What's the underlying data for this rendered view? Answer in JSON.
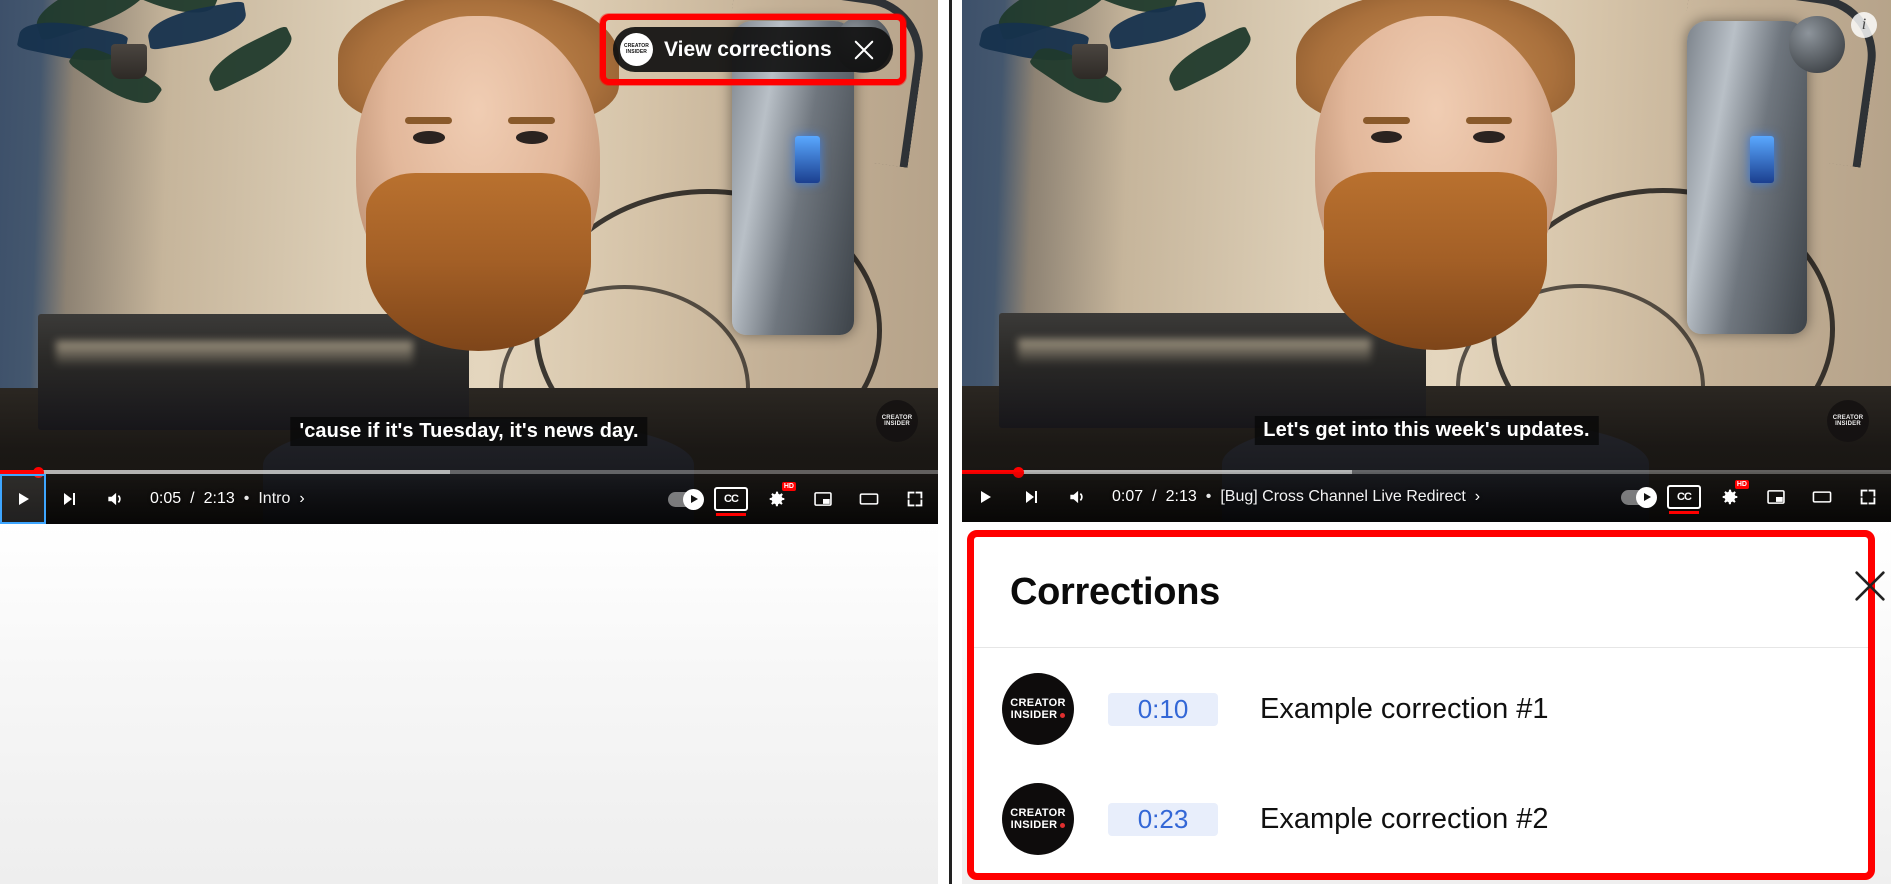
{
  "left_player": {
    "highlight_pill": {
      "avatar_line1": "CREATOR",
      "avatar_line2": "INSIDER",
      "label": "View corrections",
      "close_icon": "close-icon"
    },
    "caption": "'cause if it's Tuesday, it's news day.",
    "watermark_line1": "CREATOR",
    "watermark_line2": "INSIDER",
    "controls": {
      "play_icon": "play-icon",
      "next_icon": "next-video-icon",
      "volume_icon": "volume-icon",
      "current_time": "0:05",
      "separator": "/",
      "duration": "2:13",
      "chapter_dot": "•",
      "chapter": "Intro",
      "chapter_chevron": "›",
      "autoplay_icon": "autoplay-toggle",
      "captions_icon": "closed-captions-icon",
      "captions_label": "CC",
      "settings_icon": "settings-gear-icon",
      "settings_badge": "HD",
      "miniplayer_icon": "miniplayer-icon",
      "theater_icon": "theater-mode-icon",
      "fullscreen_icon": "fullscreen-icon"
    },
    "progress": {
      "played_percent": 4,
      "buffered_percent": 48
    }
  },
  "right_player": {
    "info_icon": "info-icon",
    "caption": "Let's get into this week's updates.",
    "watermark_line1": "CREATOR",
    "watermark_line2": "INSIDER",
    "controls": {
      "play_icon": "play-icon",
      "next_icon": "next-video-icon",
      "volume_icon": "volume-icon",
      "current_time": "0:07",
      "separator": "/",
      "duration": "2:13",
      "chapter_dot": "•",
      "chapter": "[Bug] Cross Channel Live Redirect",
      "chapter_chevron": "›",
      "autoplay_icon": "autoplay-toggle",
      "captions_icon": "closed-captions-icon",
      "captions_label": "CC",
      "settings_icon": "settings-gear-icon",
      "settings_badge": "HD",
      "miniplayer_icon": "miniplayer-icon",
      "theater_icon": "theater-mode-icon",
      "fullscreen_icon": "fullscreen-icon"
    },
    "progress": {
      "played_percent": 6,
      "buffered_percent": 42
    }
  },
  "corrections_panel": {
    "title": "Corrections",
    "close_icon": "close-icon",
    "items": [
      {
        "avatar_line1": "CREATOR",
        "avatar_line2": "INSIDER",
        "timestamp": "0:10",
        "text": "Example correction #1"
      },
      {
        "avatar_line1": "CREATOR",
        "avatar_line2": "INSIDER",
        "timestamp": "0:23",
        "text": "Example correction #2"
      }
    ]
  },
  "colors": {
    "highlight_red": "#ff0000",
    "youtube_red": "#ff0000",
    "timestamp_blue": "#3367d6",
    "timestamp_blue_bg": "#e8eefb",
    "focus_blue": "#3ea6ff",
    "panel_bg": "#ffffff"
  }
}
